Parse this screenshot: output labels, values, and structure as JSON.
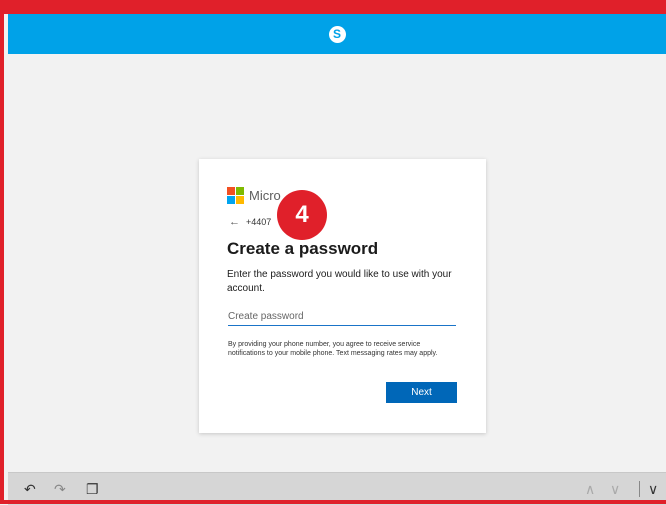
{
  "app": {
    "logo_letter": "S"
  },
  "card": {
    "brand": "Micro",
    "account_id": "+4407",
    "title": "Create a password",
    "description": "Enter the password you would like to use with your account.",
    "password_placeholder": "Create password",
    "disclaimer": "By providing your phone number, you agree to receive service notifications to your mobile phone. Text messaging rates may apply.",
    "next_label": "Next"
  },
  "overlay": {
    "step_number": "4"
  },
  "bottombar": {
    "icons": [
      "undo-icon",
      "redo-icon",
      "copy-icon",
      "chevron-up-icon",
      "chevron-down-icon",
      "collapse-icon"
    ]
  },
  "colors": {
    "skype_blue": "#00a2e8",
    "ms_button": "#0067b8",
    "frame_red": "#e0202a"
  }
}
